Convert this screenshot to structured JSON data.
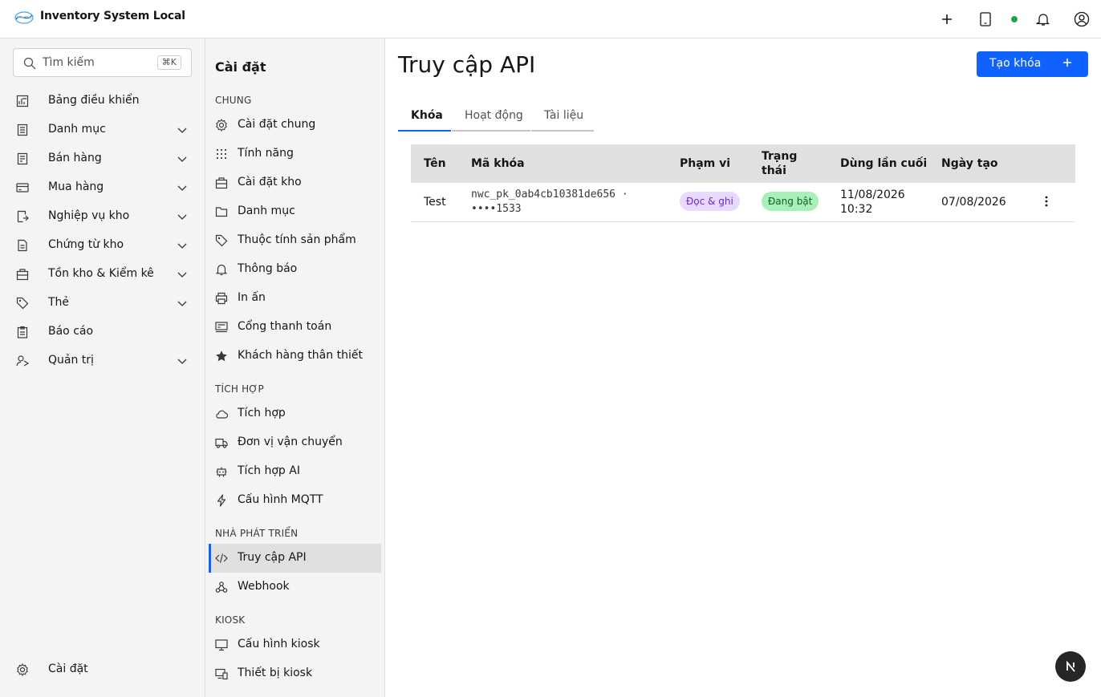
{
  "header": {
    "app_title": "Inventory System Local",
    "logo_icon": "brand-logo",
    "status_color": "#24a148"
  },
  "search": {
    "placeholder": "Tìm kiếm",
    "shortcut": "⌘K"
  },
  "sidebar": {
    "items": [
      {
        "label": "Bảng điều khiển",
        "icon": "dashboard-icon",
        "expandable": false
      },
      {
        "label": "Danh mục",
        "icon": "catalog-icon",
        "expandable": true
      },
      {
        "label": "Bán hàng",
        "icon": "sales-icon",
        "expandable": true
      },
      {
        "label": "Mua hàng",
        "icon": "card-icon",
        "expandable": true
      },
      {
        "label": "Nghiệp vụ kho",
        "icon": "warehouse-ops-icon",
        "expandable": true
      },
      {
        "label": "Chứng từ kho",
        "icon": "document-icon",
        "expandable": true
      },
      {
        "label": "Tồn kho & Kiểm kê",
        "icon": "inventory-icon",
        "expandable": true
      },
      {
        "label": "Thẻ",
        "icon": "tag-icon",
        "expandable": true
      },
      {
        "label": "Báo cáo",
        "icon": "report-icon",
        "expandable": false
      },
      {
        "label": "Quản trị",
        "icon": "admin-icon",
        "expandable": true
      }
    ],
    "footer_label": "Cài đặt"
  },
  "settings": {
    "title": "Cài đặt",
    "sections": [
      {
        "label": "CHUNG",
        "items": [
          "Cài đặt chung",
          "Tính năng",
          "Cài đặt kho",
          "Danh mục",
          "Thuộc tính sản phẩm",
          "Thông báo",
          "In ấn",
          "Cổng thanh toán",
          "Khách hàng thân thiết"
        ]
      },
      {
        "label": "TÍCH HỢP",
        "items": [
          "Tích hợp",
          "Đơn vị vận chuyển",
          "Tích hợp AI",
          "Cấu hình MQTT"
        ]
      },
      {
        "label": "NHÀ PHÁT TRIỂN",
        "items": [
          "Truy cập API",
          "Webhook"
        ]
      },
      {
        "label": "KIOSK",
        "items": [
          "Cấu hình kiosk",
          "Thiết bị kiosk"
        ]
      }
    ],
    "active_item": "Truy cập API"
  },
  "main": {
    "title": "Truy cập API",
    "create_button": "Tạo khóa",
    "tabs": [
      "Khóa",
      "Hoạt động",
      "Tài liệu"
    ],
    "active_tab": "Khóa",
    "table": {
      "headers": [
        "Tên",
        "Mã khóa",
        "Phạm vi",
        "Trạng thái",
        "Dùng lần cuối",
        "Ngày tạo"
      ],
      "rows": [
        {
          "name": "Test",
          "key_line1": "nwc_pk_0ab4cb10381de656 ·",
          "key_line2": "••••1533",
          "scope": "Đọc & ghi",
          "status": "Đang bật",
          "last_used_line1": "11/08/2026",
          "last_used_line2": "10:32",
          "created": "07/08/2026"
        }
      ]
    }
  },
  "colors": {
    "primary": "#0f62fe",
    "scope_tag_bg": "#e8daff",
    "status_tag_bg": "#a7f0ba"
  }
}
